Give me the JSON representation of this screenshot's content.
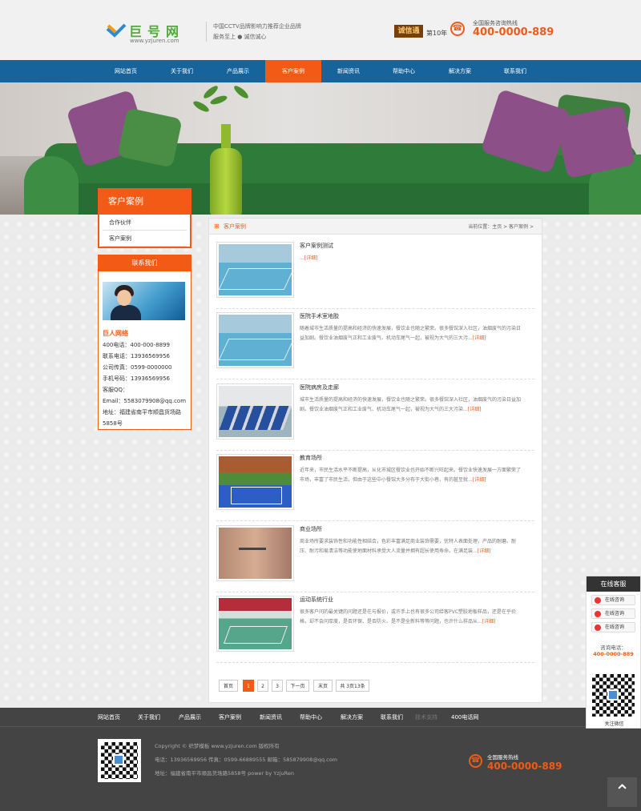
{
  "header": {
    "logo_text": "巨号网",
    "logo_url": "www.yzjuren.com",
    "slogan": [
      "中国CCTV品牌影响力推荐企业品牌",
      "服务至上 ● 诚信诚心"
    ],
    "credit_badge": "诚信通",
    "credit_year": "第10年",
    "hotline_label": "全国服务咨询热线",
    "hotline": "400-0000-889"
  },
  "nav": {
    "items": [
      "网站首页",
      "关于我们",
      "产品展示",
      "客户案例",
      "新闻资讯",
      "帮助中心",
      "解决方案",
      "联系我们"
    ],
    "active_index": 3
  },
  "sidebar": {
    "title": "客户案例",
    "items": [
      "合作伙伴",
      "客户案例"
    ],
    "contact_title": "联系我们",
    "company": "巨人网络",
    "contact_lines": [
      "400电话：400-000-8899",
      "联系电话：13936569956",
      "公司传真：0599-0000000",
      "手机号码：13936569956",
      "客服QQ：",
      "Email：5583079908@qq.com",
      "地址：福建省南平市顺昌货场路",
      "5858号"
    ]
  },
  "content": {
    "title": "客户案例",
    "breadcrumb": "当前位置：主页 > 客户案例 >",
    "cases": [
      {
        "title": "客户案例测试",
        "desc": "...",
        "more": "[详细]",
        "thumb": "gym"
      },
      {
        "title": "医院手术室地胶",
        "desc": "随着城市生活质量的提高和经济的快速发展，餐饮业也随之繁荣。很多餐馆深入社区，油烟废气的污染日益加剧。餐饮业油烟废气正和工业废气、机动车尾气一起，被视为大气的三大污...",
        "more": "[详细]",
        "thumb": "gym"
      },
      {
        "title": "医院病房及走廊",
        "desc": "城市生活质量的提高和经济的快速发展，餐饮业也随之繁荣。很多餐馆深入社区，油烟废气的污染日益加剧。餐饮业油烟废气正和工业废气、机动车尾气一起，被视为大气的三大污染...",
        "more": "[详细]",
        "thumb": "table-room"
      },
      {
        "title": "教育场所",
        "desc": "近年来，市民生活水平不断提高，从化市城区餐饮业也开始不断兴旺起来。餐饮业快速发展一方面繁荣了市场，丰富了市民生活，但由于这些中小餐馆大多分布于大街小巷，有的甚至就...",
        "more": "[详细]",
        "thumb": "court"
      },
      {
        "title": "商业场所",
        "desc": "商业场所要求装饰性和功能性相结合，色彩丰富满足商业装饰需要，优特人表面处理，产品的耐磨、耐压、耐污和易清洁等功能使地面材料承受大人流量并拥有超长使用寿命。在满足装...",
        "more": "[详细]",
        "thumb": "wood"
      },
      {
        "title": "运动系统行业",
        "desc": "很多客户问的最关键的问题还是在与报价，或许手上也有很多公司给客PVC塑胶地板样品，还是在乎价格，却不会问厚度，是否环保、是否防火、是不是全新料等等问题，也许什么样品从...",
        "more": "[详细]",
        "thumb": "sports"
      }
    ],
    "pager": [
      "首页",
      "1",
      "2",
      "3",
      "下一页",
      "末页",
      "共 3页13条"
    ]
  },
  "footer": {
    "links": [
      "网站首页",
      "关于我们",
      "产品展示",
      "客户案例",
      "新闻资讯",
      "帮助中心",
      "解决方案",
      "联系我们",
      "技术支持",
      "400电话网"
    ],
    "copyright": "Copyright © 织梦模板 www.yzjuren.com 版权所有",
    "contact": "电话：13936569956 传真：0599-66889555 邮箱：585879908@qq.com",
    "address": "地址：福建省南平市顺昌货场路5858号 power by YzjuRen",
    "hotline_label": "全国服务热线",
    "hotline": "400-0000-889"
  },
  "service": {
    "title": "在线客服",
    "buttons": [
      "在线咨询",
      "在线咨询",
      "在线咨询"
    ],
    "phone_label": "咨询电话：",
    "phone": "400-0000-889",
    "follow": "关注微信"
  },
  "colors": {
    "brand_orange": "#f35a15",
    "nav_blue": "#17649c",
    "footer_dark": "#444444"
  }
}
